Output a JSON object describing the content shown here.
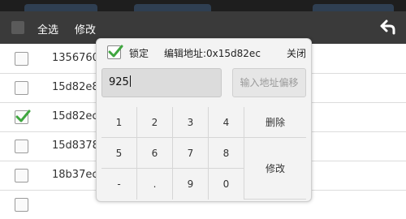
{
  "topbar": {
    "select_all_label": "全选",
    "edit_label": "修改"
  },
  "list": {
    "rows": [
      {
        "address": "1356760",
        "checked": false
      },
      {
        "address": "15d82e8",
        "checked": false
      },
      {
        "address": "15d82ec",
        "checked": true
      },
      {
        "address": "15d8378",
        "checked": false
      },
      {
        "address": "18b37ec",
        "checked": false
      },
      {
        "address": "",
        "checked": false
      }
    ]
  },
  "dialog": {
    "lock_label": "锁定",
    "lock_checked": true,
    "address_label": "编辑地址:0x15d82ec",
    "close_label": "关闭",
    "value_input": "925",
    "offset_button_label": "输入地址偏移",
    "keys": {
      "k1": "1",
      "k2": "2",
      "k3": "3",
      "k4": "4",
      "k5": "5",
      "k6": "6",
      "k7": "7",
      "k8": "8",
      "minus": "-",
      "dot": ".",
      "k9": "9",
      "k0": "0",
      "delete": "删除",
      "modify": "修改"
    }
  },
  "colors": {
    "topbar_bg": "#3a3a3a",
    "check_green": "#3fa63f",
    "dialog_bg": "#f3f3f3"
  }
}
